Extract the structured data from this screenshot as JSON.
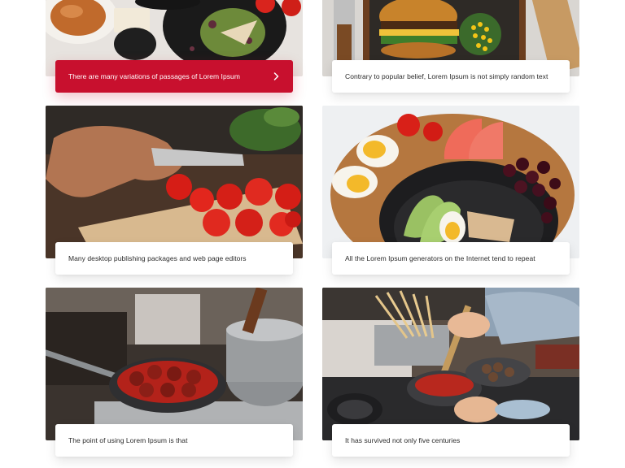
{
  "colors": {
    "accent": "#c8102e",
    "caption_text": "#2b2b2b",
    "background": "#ffffff"
  },
  "cards": [
    {
      "caption": "There are many variations of passages of Lorem Ipsum",
      "active": true,
      "icon": "chevron-right-icon",
      "photo": "grilled-chicken-salad-plate"
    },
    {
      "caption": "Contrary to popular belief, Lorem Ipsum is not simply random text",
      "active": false,
      "photo": "burger-and-corn-board"
    },
    {
      "caption": "Many desktop publishing packages and web page editors",
      "active": false,
      "photo": "slicing-cherry-tomatoes"
    },
    {
      "caption": "All the Lorem Ipsum generators on the Internet tend to repeat",
      "active": false,
      "photo": "eggs-grapefruit-avocado-bowl"
    },
    {
      "caption": "The point of using Lorem Ipsum is that",
      "active": false,
      "photo": "meatballs-in-pan-on-stove"
    },
    {
      "caption": "It has survived not only five centuries",
      "active": false,
      "photo": "cooking-pasta-and-meatballs"
    }
  ]
}
